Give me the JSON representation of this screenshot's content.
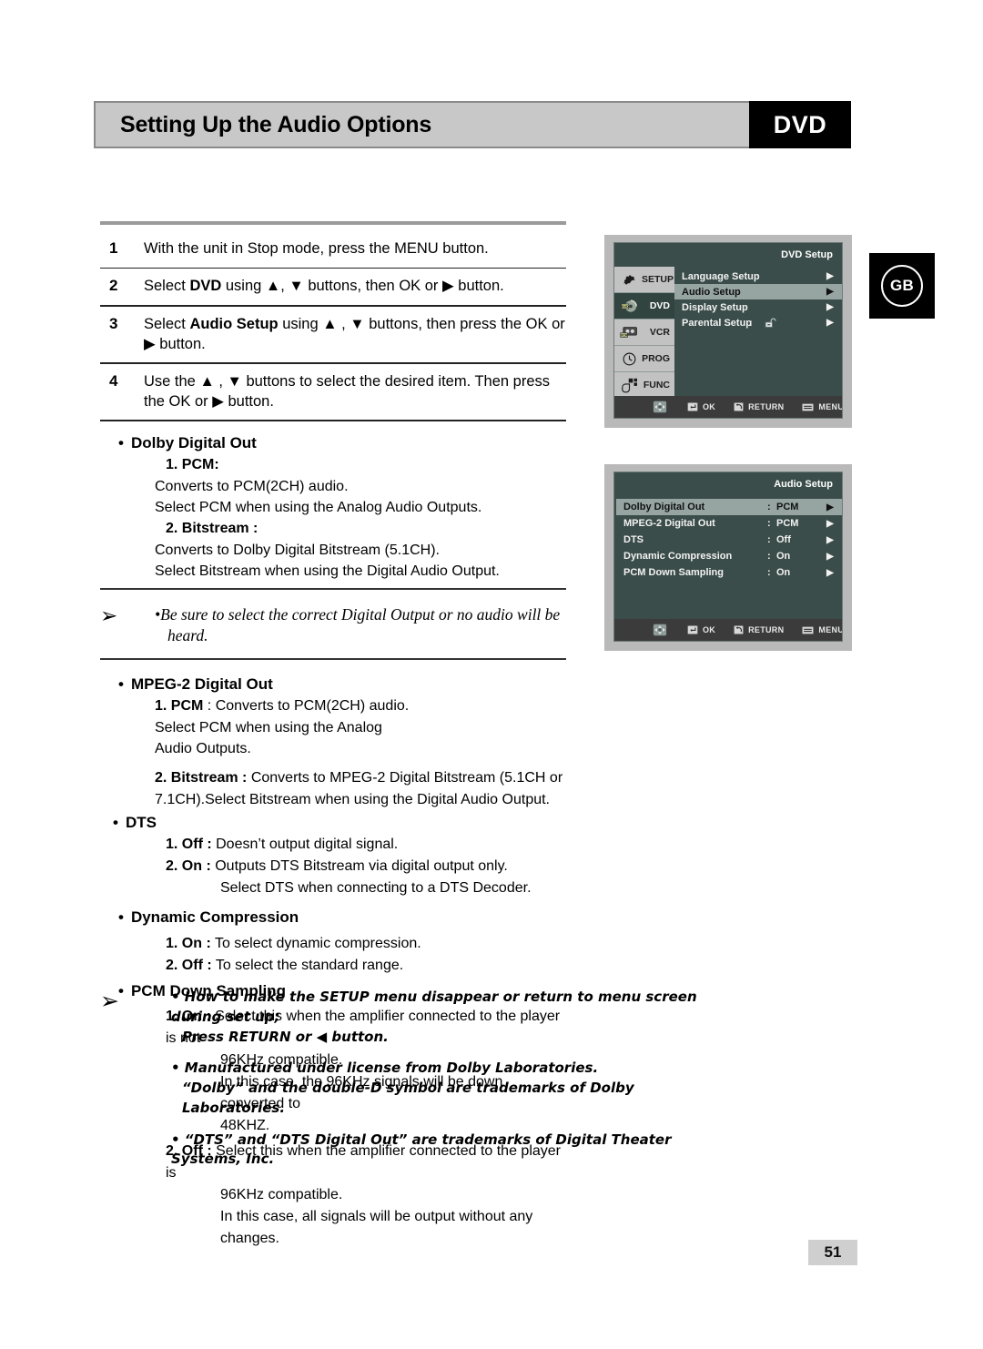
{
  "header": {
    "title": "Setting Up the Audio Options",
    "badge": "DVD"
  },
  "region_badge": {
    "code": "GB"
  },
  "page_number": "51",
  "steps": [
    {
      "num": "1",
      "text_before": "With the unit in Stop mode, press the MENU button.",
      "bold": "",
      "text_after": ""
    },
    {
      "num": "2",
      "text_before": "Select ",
      "bold": "DVD",
      "text_after": " using ▲, ▼ buttons, then OK or ▶ button."
    },
    {
      "num": "3",
      "text_before": "Select ",
      "bold": "Audio Setup",
      "text_after": " using ▲ , ▼ buttons, then press the OK or ▶ button."
    },
    {
      "num": "4",
      "text_before": "Use the ▲ , ▼ buttons to select the desired item. Then press the OK or ▶ button.",
      "bold": "",
      "text_after": ""
    }
  ],
  "sections": {
    "dolby": {
      "heading": "Dolby Digital Out",
      "item1_head": "1. PCM:",
      "item1_line1": "Converts to PCM(2CH) audio.",
      "item1_line2": "Select PCM when using the Analog Audio Outputs.",
      "item2_head": "2. Bitstream :",
      "item2_line1": "Converts to Dolby Digital Bitstream (5.1CH).",
      "item2_line2": "Select Bitstream when using the Digital Audio Output."
    },
    "note_digital_output": {
      "arrow": "➢",
      "line1": "•Be sure to select the correct Digital Output or no audio will be",
      "line2": "heard."
    },
    "mpeg2": {
      "heading": "MPEG-2 Digital Out",
      "item1_num": "1",
      "item1_bold": ". PCM",
      "item1_rest": " :  Converts to PCM(2CH) audio.",
      "item1_line2": "Select PCM when using the Analog",
      "item1_line3": "Audio Outputs.",
      "item2_num": "2",
      "item2_bold": ". Bitstream :",
      "item2_rest": " Converts to MPEG-2 Digital Bitstream (5.1CH or",
      "item2_line2": "7.1CH).Select Bitstream when using the Digital Audio Output."
    },
    "dts": {
      "heading": "DTS",
      "item1_bold": "1. Off :",
      "item1_rest": " Doesn’t output digital signal.",
      "item2_bold": "2. On :",
      "item2_rest": " Outputs DTS Bitstream via digital output only.",
      "item2_line2": "Select DTS when connecting to a DTS Decoder."
    },
    "dynamic_compression": {
      "heading": "Dynamic Compression",
      "item1_bold": "1. On :",
      "item1_rest": " To select dynamic compression.",
      "item2_bold": "2. Off :",
      "item2_rest": " To select the standard range."
    },
    "pcm_down_sampling": {
      "heading": "PCM Down Sampling",
      "item1_bold": "1. On :",
      "item1_rest": " Select this when the amplifier connected to the player is not",
      "item1_line2": "96KHz compatible.",
      "item1_line3": "In this case, the 96KHz signals will be down converted to",
      "item1_line4": "48KHZ.",
      "item2_bold": "2. Off :",
      "item2_rest": " Select this when the amplifier connected to the player is",
      "item2_line2": "96KHz compatible.",
      "item2_line3": "In this case, all signals will be output without any changes."
    }
  },
  "bottom_notes": {
    "arrow": "➢",
    "items": [
      {
        "line1": "• How to make the SETUP menu disappear or return to menu screen during set up;",
        "line2": "Press RETURN or ◀ button."
      },
      {
        "line1": "• Manufactured under license from Dolby Laboratories.",
        "line2": "“Dolby” and the double-D symbol are trademarks of Dolby Laboratories."
      },
      {
        "line1": "• “DTS” and “DTS Digital Out” are trademarks of Digital Theater Systems, Inc.",
        "line2": ""
      }
    ]
  },
  "tv_screens": [
    {
      "id": "dvd-setup",
      "title": "DVD Setup",
      "side_items": [
        {
          "label": "SETUP",
          "icon": "gear-icon",
          "selected": false
        },
        {
          "label": "DVD",
          "icon": "disc-icon",
          "selected": true
        },
        {
          "label": "VCR",
          "icon": "cassette-icon",
          "selected": false
        },
        {
          "label": "PROG",
          "icon": "clock-icon",
          "selected": false
        },
        {
          "label": "FUNC",
          "icon": "hand-icon",
          "selected": false
        }
      ],
      "rows": [
        {
          "label": "Language Setup",
          "colon": "",
          "value": "",
          "arrow": "▶",
          "highlighted": false,
          "lock": false
        },
        {
          "label": "Audio Setup",
          "colon": "",
          "value": "",
          "arrow": "▶",
          "highlighted": true,
          "lock": false
        },
        {
          "label": "Display Setup",
          "colon": "",
          "value": "",
          "arrow": "▶",
          "highlighted": false,
          "lock": false
        },
        {
          "label": "Parental Setup",
          "colon": ":",
          "value": "",
          "arrow": "▶",
          "highlighted": false,
          "lock": true
        }
      ],
      "footer": [
        {
          "icon": "dpad-icon",
          "label": ""
        },
        {
          "icon": "ok-icon",
          "label": "OK"
        },
        {
          "icon": "return-icon",
          "label": "RETURN"
        },
        {
          "icon": "menu-icon",
          "label": "MENU"
        }
      ]
    },
    {
      "id": "audio-setup",
      "title": "Audio Setup",
      "side_items": [],
      "rows": [
        {
          "label": "Dolby Digital Out",
          "colon": ":",
          "value": "PCM",
          "arrow": "▶",
          "highlighted": true,
          "lock": false
        },
        {
          "label": "MPEG-2 Digital Out",
          "colon": ":",
          "value": "PCM",
          "arrow": "▶",
          "highlighted": false,
          "lock": false
        },
        {
          "label": "DTS",
          "colon": ":",
          "value": "Off",
          "arrow": "▶",
          "highlighted": false,
          "lock": false
        },
        {
          "label": "Dynamic Compression",
          "colon": ":",
          "value": "On",
          "arrow": "▶",
          "highlighted": false,
          "lock": false
        },
        {
          "label": "PCM Down Sampling",
          "colon": ":",
          "value": "On",
          "arrow": "▶",
          "highlighted": false,
          "lock": false
        }
      ],
      "footer": [
        {
          "icon": "dpad-icon",
          "label": ""
        },
        {
          "icon": "ok-icon",
          "label": "OK"
        },
        {
          "icon": "return-icon",
          "label": "RETURN"
        },
        {
          "icon": "menu-icon",
          "label": "MENU"
        }
      ]
    }
  ],
  "colors": {
    "header_bar": "#c8c8c8",
    "badge_bg": "#000000",
    "tv_bg": "#3b4d4a",
    "tv_highlight": "#96a5a1",
    "tv_side_selected": "#31443f",
    "page_num_bg": "#cfcfcf"
  }
}
